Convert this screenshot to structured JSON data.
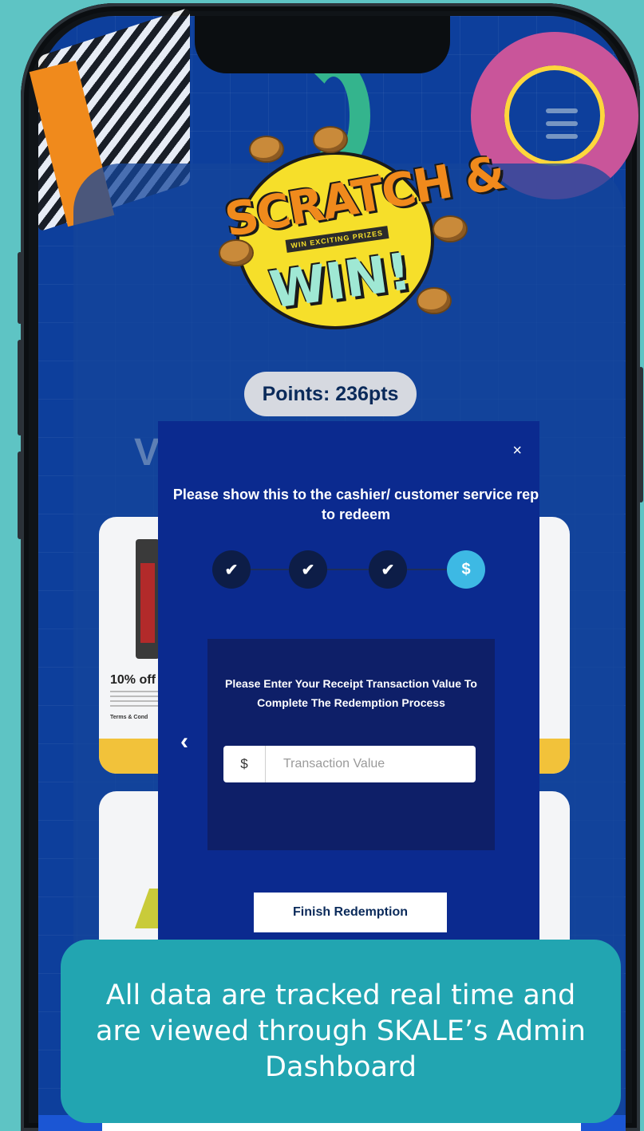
{
  "header": {
    "logo_title": "SCRATCH &",
    "logo_tagline": "WIN EXCITING PRIZES",
    "logo_win": "WIN!"
  },
  "points": {
    "label": "Points: 236pts"
  },
  "background": {
    "section_heading_partial": "V",
    "voucher1_title": "10% off",
    "voucher1_terms": "Terms & Cond"
  },
  "modal": {
    "close_label": "×",
    "title": "Please show this to the cashier/ customer service rep to redeem",
    "steps": [
      {
        "label": "✔",
        "state": "done"
      },
      {
        "label": "✔",
        "state": "done"
      },
      {
        "label": "✔",
        "state": "done"
      },
      {
        "label": "$",
        "state": "active"
      }
    ],
    "instruction": "Please Enter Your Receipt Transaction Value To Complete The Redemption Process",
    "currency_prefix": "$",
    "input_placeholder": "Transaction Value",
    "input_value": "",
    "back_label": "‹",
    "finish_button": "Finish Redemption"
  },
  "caption": {
    "text": "All data are tracked real time and are viewed through SKALE’s Admin Dashboard"
  },
  "colors": {
    "background": "#5ec4c4",
    "modal": "#0b2a8f",
    "active_step": "#3db9e4",
    "caption": "#22a5b1"
  },
  "icons": {
    "menu": "hamburger-menu-icon",
    "close": "close-icon",
    "back": "chevron-left-icon",
    "check": "check-icon",
    "dollar": "dollar-icon"
  }
}
